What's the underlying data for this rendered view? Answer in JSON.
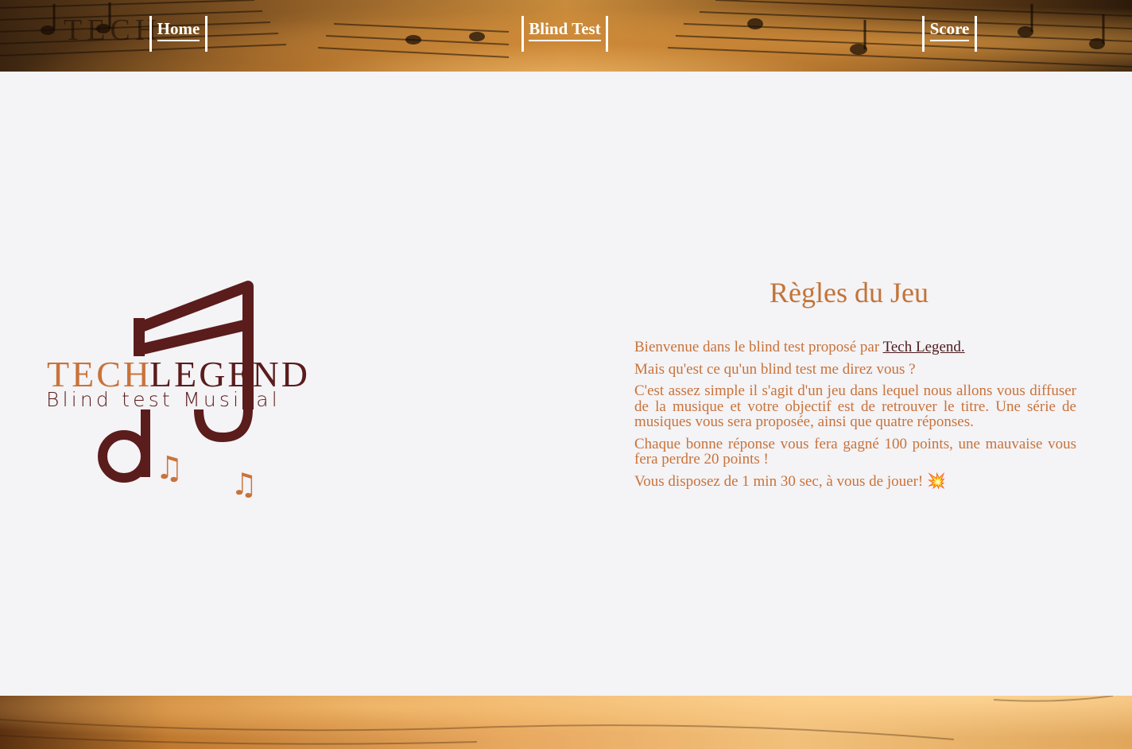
{
  "nav": {
    "home": "Home",
    "blind_test": "Blind Test",
    "score": "Score"
  },
  "logo": {
    "tech": "TECH",
    "legend": "LEGEND",
    "subtitle": "Blind test Musical"
  },
  "rules": {
    "title": "Règles du Jeu",
    "intro": "Bienvenue dans le blind test proposé par ",
    "brand_link": "Tech Legend.",
    "p2": "Mais qu'est ce qu'un blind test me direz vous ?",
    "p3": "C'est assez simple il s'agit d'un jeu dans lequel nous allons vous diffuser de la musique et votre objectif est de retrouver le titre. Une série de musiques vous sera proposée, ainsi que quatre réponses.",
    "p4": "Chaque bonne réponse vous fera gagné 100 points, une mauvaise vous fera perdre 20 points !",
    "p5": "Vous disposez de 1 min 30 sec, à vous de jouer! ",
    "p5_emoji": "💥"
  },
  "colors": {
    "accent": "#c8733a",
    "dark_brown": "#5b1c1c",
    "background": "#f4f3f6"
  }
}
